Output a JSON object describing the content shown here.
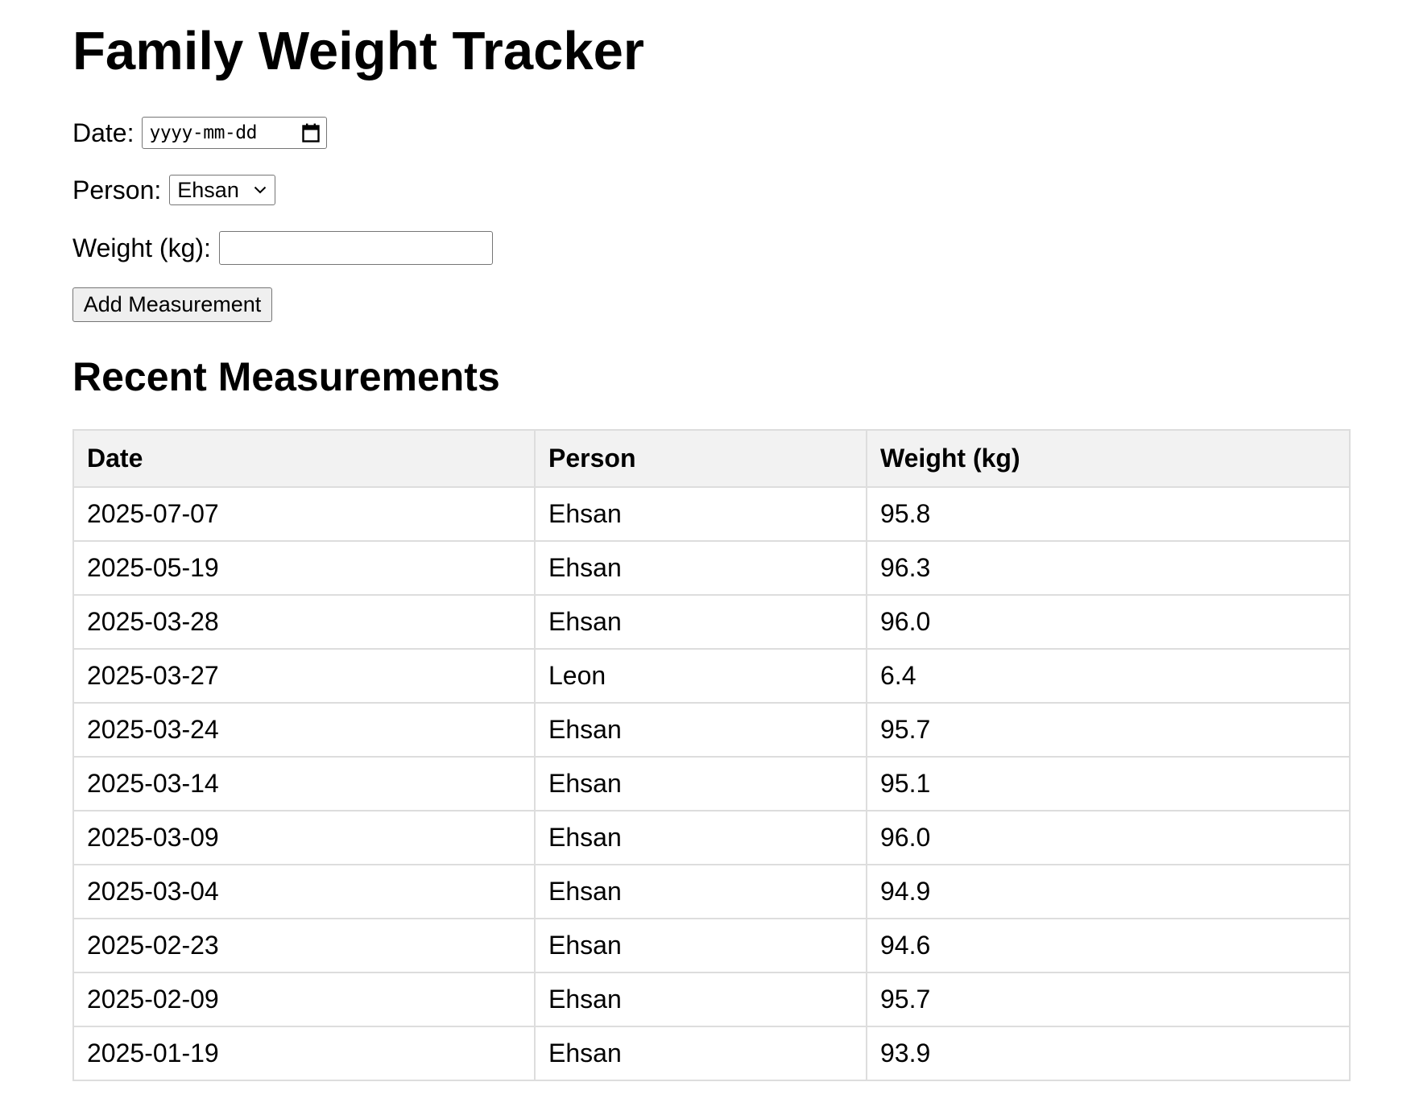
{
  "title": "Family Weight Tracker",
  "form": {
    "date_label": "Date:",
    "date_placeholder": "yyyy-mm-dd",
    "person_label": "Person:",
    "person_selected": "Ehsan",
    "weight_label": "Weight (kg):",
    "weight_value": "",
    "submit_label": "Add Measurement"
  },
  "recent": {
    "heading": "Recent Measurements",
    "columns": [
      "Date",
      "Person",
      "Weight (kg)"
    ],
    "rows": [
      [
        "2025-07-07",
        "Ehsan",
        "95.8"
      ],
      [
        "2025-05-19",
        "Ehsan",
        "96.3"
      ],
      [
        "2025-03-28",
        "Ehsan",
        "96.0"
      ],
      [
        "2025-03-27",
        "Leon",
        "6.4"
      ],
      [
        "2025-03-24",
        "Ehsan",
        "95.7"
      ],
      [
        "2025-03-14",
        "Ehsan",
        "95.1"
      ],
      [
        "2025-03-09",
        "Ehsan",
        "96.0"
      ],
      [
        "2025-03-04",
        "Ehsan",
        "94.9"
      ],
      [
        "2025-02-23",
        "Ehsan",
        "94.6"
      ],
      [
        "2025-02-09",
        "Ehsan",
        "95.7"
      ],
      [
        "2025-01-19",
        "Ehsan",
        "93.9"
      ]
    ]
  },
  "icons": {
    "date_picker": "calendar-icon",
    "select_arrow": "chevron-down-icon"
  }
}
